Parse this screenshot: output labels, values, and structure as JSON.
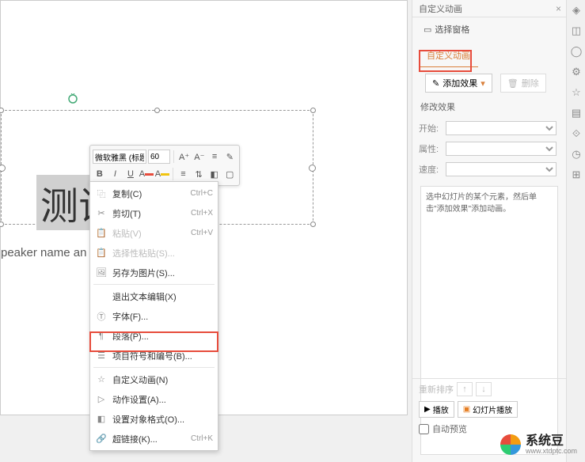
{
  "slide": {
    "title_text": "测试",
    "subtitle_text": "peaker name an"
  },
  "mini_toolbar": {
    "font_name": "微软雅黑 (标题)",
    "font_size": "60",
    "increase_font": "A⁺",
    "decrease_font": "A⁻",
    "bold": "B",
    "italic": "I",
    "underline": "U"
  },
  "context_menu": {
    "items": [
      {
        "label": "复制(C)",
        "shortcut": "Ctrl+C",
        "icon": "copy"
      },
      {
        "label": "剪切(T)",
        "shortcut": "Ctrl+X",
        "icon": "cut"
      },
      {
        "label": "粘贴(V)",
        "shortcut": "Ctrl+V",
        "icon": "paste",
        "disabled": true
      },
      {
        "label": "选择性粘贴(S)...",
        "shortcut": "",
        "icon": "paste-special",
        "disabled": true
      },
      {
        "label": "另存为图片(S)...",
        "shortcut": "",
        "icon": "save-image"
      },
      {
        "sep": true
      },
      {
        "label": "退出文本编辑(X)",
        "shortcut": "",
        "icon": ""
      },
      {
        "label": "字体(F)...",
        "shortcut": "",
        "icon": "font"
      },
      {
        "label": "段落(P)...",
        "shortcut": "",
        "icon": "paragraph"
      },
      {
        "label": "项目符号和编号(B)...",
        "shortcut": "",
        "icon": "bullets"
      },
      {
        "sep": true
      },
      {
        "label": "自定义动画(N)",
        "shortcut": "",
        "icon": "animation"
      },
      {
        "label": "动作设置(A)...",
        "shortcut": "",
        "icon": "action"
      },
      {
        "label": "设置对象格式(O)...",
        "shortcut": "",
        "icon": "format"
      },
      {
        "label": "超链接(K)...",
        "shortcut": "Ctrl+K",
        "icon": "link"
      }
    ]
  },
  "side_panel": {
    "title": "自定义动画",
    "select_pane": "选择窗格",
    "section": "自定义动画",
    "add_effect": "添加效果",
    "delete": "删除",
    "modify_section": "修改效果",
    "start_label": "开始:",
    "property_label": "属性:",
    "speed_label": "速度:",
    "hint": "选中幻灯片的某个元素，然后单击\"添加效果\"添加动画。",
    "reorder": "重新排序",
    "play": "播放",
    "slideshow": "幻灯片播放",
    "auto_preview": "自动预览"
  },
  "watermark": {
    "main": "系统豆",
    "sub": "www.xtdptc.com"
  }
}
